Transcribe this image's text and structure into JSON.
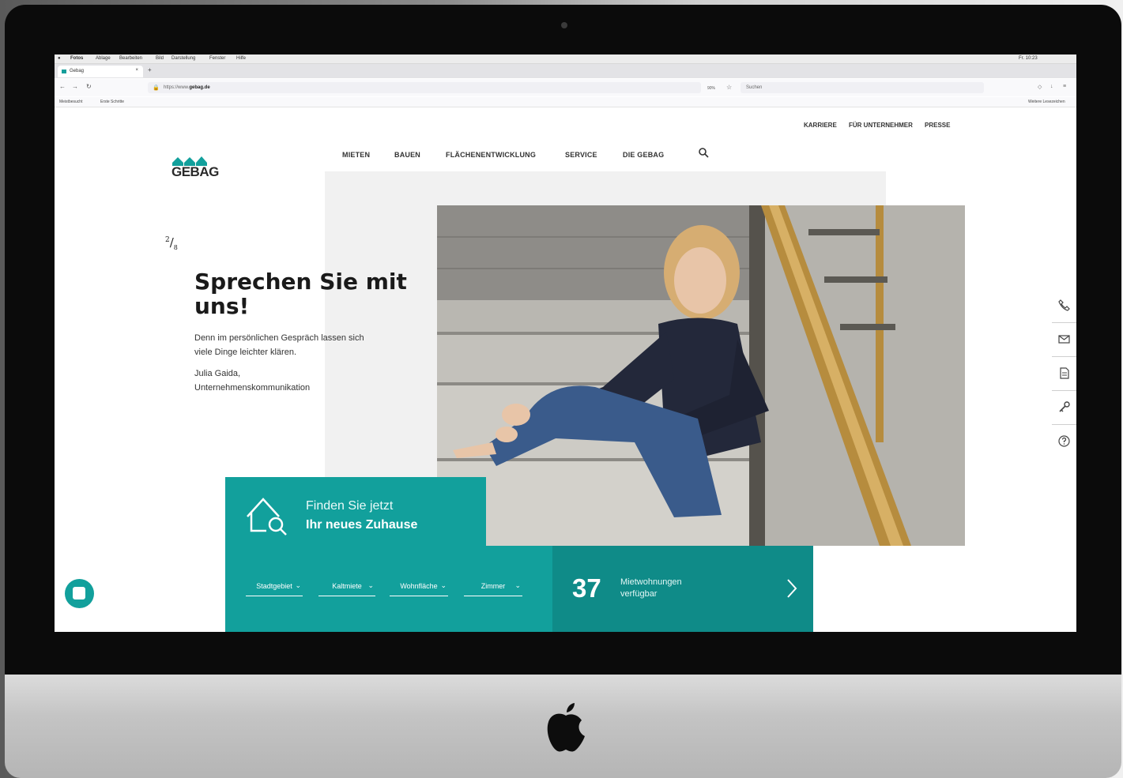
{
  "os_menu": {
    "items": [
      "Fotos",
      "Ablage",
      "Bearbeiten",
      "Bild",
      "Darstellung",
      "Fenster",
      "Hilfe"
    ],
    "status": "Fr. 10:23"
  },
  "browser": {
    "tab_title": "Gebag",
    "url_prefix": "https://www.",
    "url_domain": "gebag.de",
    "zoom": "90%",
    "search_placeholder": "Suchen",
    "bookmarks": [
      "Meistbesucht",
      "Erste Schritte"
    ],
    "other_bookmarks": "Weitere Lesezeichen"
  },
  "site": {
    "logo_text": "GEBAG",
    "brand_color": "#12a09c",
    "meta_nav": [
      "KARRIERE",
      "FÜR UNTERNEHMER",
      "PRESSE"
    ],
    "main_nav": [
      "MIETEN",
      "BAUEN",
      "FLÄCHENENTWICKLUNG",
      "SERVICE",
      "DIE GEBAG"
    ],
    "slide_current": "2",
    "slide_total": "8",
    "headline": "Sprechen Sie mit uns!",
    "body": "Denn im persönlichen Gespräch lassen sich viele Dinge leichter klären.",
    "author_name": "Julia Gaida,",
    "author_role": "Unternehmenskommunikation"
  },
  "finder": {
    "line1": "Finden Sie jetzt",
    "line2": "Ihr neues Zuhause",
    "filters": [
      "Stadtgebiet",
      "Kaltmiete",
      "Wohnfläche",
      "Zimmer"
    ],
    "count": "37",
    "count_label1": "Mietwohnungen",
    "count_label2": "verfügbar"
  },
  "sidebar_icons": [
    "phone-icon",
    "mail-icon",
    "document-icon",
    "key-icon",
    "help-icon"
  ]
}
